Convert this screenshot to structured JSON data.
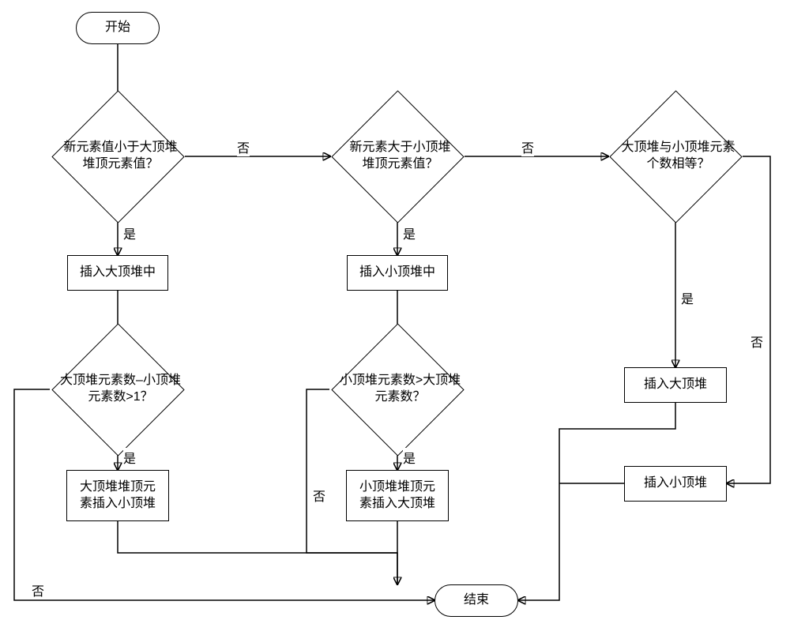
{
  "chart_data": {
    "type": "flowchart",
    "title": "",
    "nodes": [
      {
        "id": "start",
        "kind": "terminator",
        "label": "开始"
      },
      {
        "id": "d1",
        "kind": "decision",
        "label": "新元素值小于大顶堆\n堆顶元素值？"
      },
      {
        "id": "p1",
        "kind": "process",
        "label": "插入大顶堆中"
      },
      {
        "id": "d2",
        "kind": "decision",
        "label": "大顶堆元素数–小顶堆\n元素数>1？"
      },
      {
        "id": "p2",
        "kind": "process",
        "label": "大顶堆堆顶元\n素插入小顶堆"
      },
      {
        "id": "d3",
        "kind": "decision",
        "label": "新元素大于小顶堆\n堆顶元素值？"
      },
      {
        "id": "p3",
        "kind": "process",
        "label": "插入小顶堆中"
      },
      {
        "id": "d4",
        "kind": "decision",
        "label": "小顶堆元素数>大顶堆\n元素数？"
      },
      {
        "id": "p4",
        "kind": "process",
        "label": "小顶堆堆顶元\n素插入大顶堆"
      },
      {
        "id": "d5",
        "kind": "decision",
        "label": "大顶堆与小顶堆元素\n个数相等？"
      },
      {
        "id": "p5",
        "kind": "process",
        "label": "插入大顶堆"
      },
      {
        "id": "p6",
        "kind": "process",
        "label": "插入小顶堆"
      },
      {
        "id": "end",
        "kind": "terminator",
        "label": "结束"
      }
    ],
    "edges": [
      {
        "from": "start",
        "to": "d1"
      },
      {
        "from": "d1",
        "to": "p1",
        "label": "是"
      },
      {
        "from": "d1",
        "to": "d3",
        "label": "否"
      },
      {
        "from": "p1",
        "to": "d2"
      },
      {
        "from": "d2",
        "to": "p2",
        "label": "是"
      },
      {
        "from": "d2",
        "to": "end",
        "label": "否"
      },
      {
        "from": "p2",
        "to": "end"
      },
      {
        "from": "d3",
        "to": "p3",
        "label": "是"
      },
      {
        "from": "d3",
        "to": "d5",
        "label": "否"
      },
      {
        "from": "p3",
        "to": "d4"
      },
      {
        "from": "d4",
        "to": "p4",
        "label": "是"
      },
      {
        "from": "d4",
        "to": "end",
        "label": "否"
      },
      {
        "from": "p4",
        "to": "end"
      },
      {
        "from": "d5",
        "to": "p5",
        "label": "是"
      },
      {
        "from": "d5",
        "to": "p6",
        "label": "否"
      },
      {
        "from": "p5",
        "to": "end"
      },
      {
        "from": "p6",
        "to": "end"
      }
    ]
  },
  "labels": {
    "yes": "是",
    "no": "否"
  },
  "start": "开始",
  "end": "结束",
  "d1_l1": "新元素值小于大顶堆",
  "d1_l2": "堆顶元素值？",
  "d3_l1": "新元素大于小顶堆",
  "d3_l2": "堆顶元素值？",
  "d5_l1": "大顶堆与小顶堆元素",
  "d5_l2": "个数相等？",
  "p1": "插入大顶堆中",
  "p3": "插入小顶堆中",
  "d2_l1": "大顶堆元素数–小顶堆",
  "d2_l2": "元素数>1？",
  "d4_l1": "小顶堆元素数>大顶堆",
  "d4_l2": "元素数？",
  "p2_l1": "大顶堆堆顶元",
  "p2_l2": "素插入小顶堆",
  "p4_l1": "小顶堆堆顶元",
  "p4_l2": "素插入大顶堆",
  "p5": "插入大顶堆",
  "p6": "插入小顶堆"
}
